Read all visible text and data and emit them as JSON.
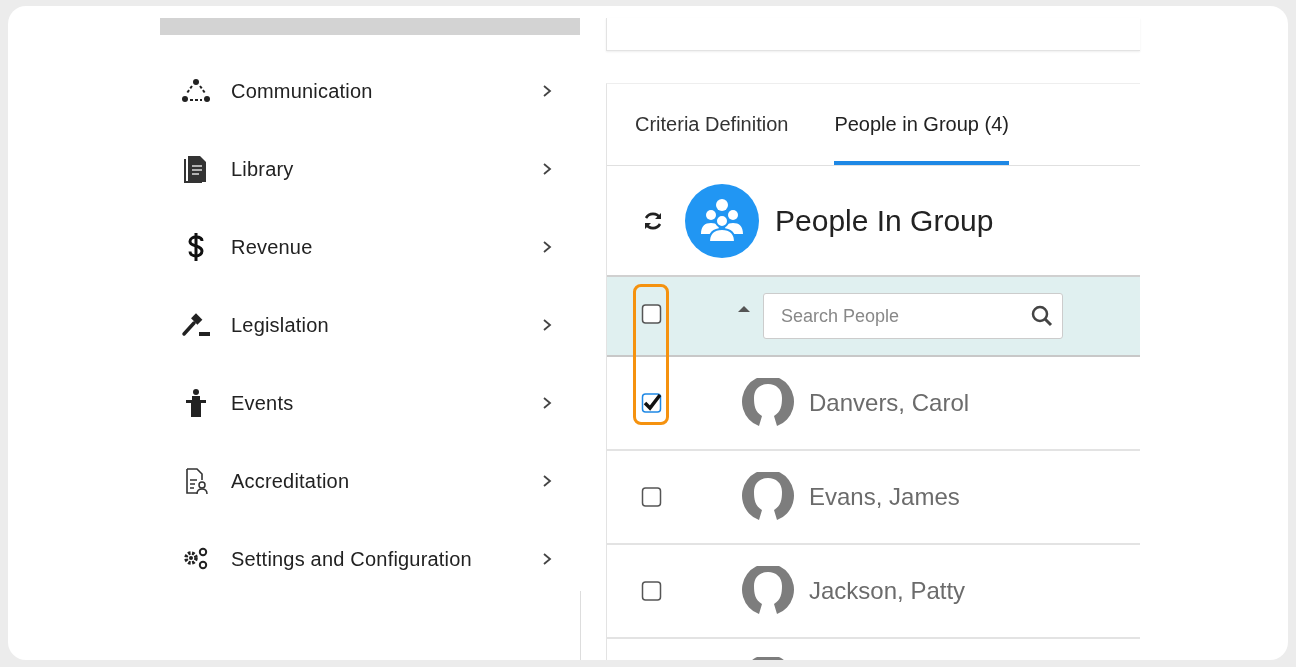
{
  "sidebar": {
    "items": [
      {
        "label": "Communication"
      },
      {
        "label": "Library"
      },
      {
        "label": "Revenue"
      },
      {
        "label": "Legislation"
      },
      {
        "label": "Events"
      },
      {
        "label": "Accreditation"
      },
      {
        "label": "Settings and Configuration"
      }
    ]
  },
  "tabs": [
    {
      "label": "Criteria Definition",
      "selected": false
    },
    {
      "label": "People in Group (4)",
      "selected": true
    }
  ],
  "panel": {
    "title": "People In Group"
  },
  "select_all": {
    "checked": false
  },
  "search": {
    "placeholder": "Search People"
  },
  "people": [
    {
      "name": "Danvers, Carol",
      "checked": true
    },
    {
      "name": "Evans, James",
      "checked": false
    },
    {
      "name": "Jackson, Patty",
      "checked": false
    }
  ]
}
